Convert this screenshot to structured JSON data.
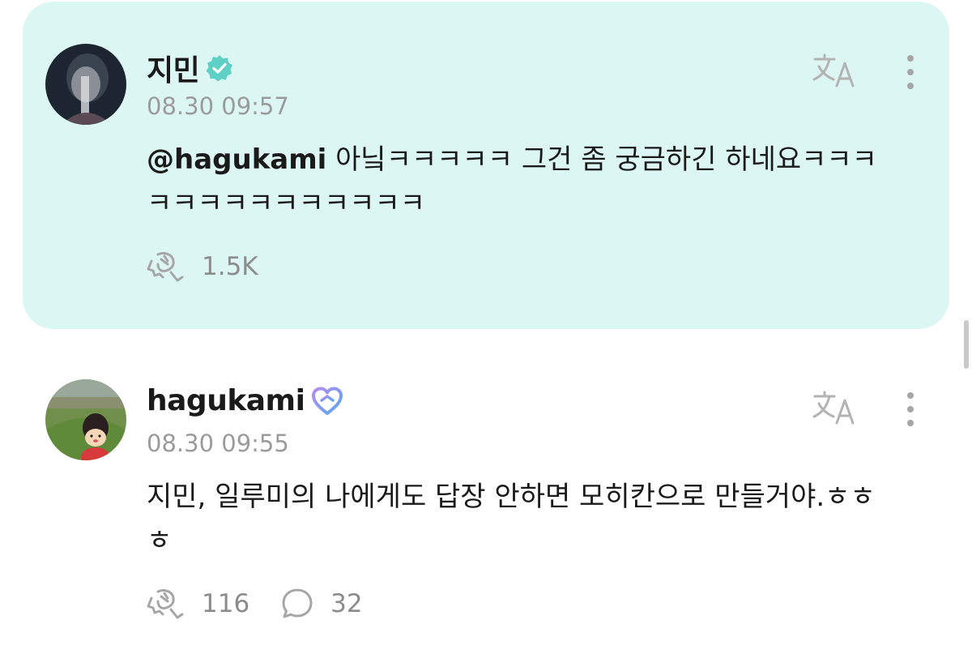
{
  "posts": [
    {
      "author": "지민",
      "verified_badge": "verified-check-icon",
      "badge_color": "#5fd0c4",
      "time": "08.30 09:57",
      "mention": "@hagukami",
      "text": " 아닠ㅋㅋㅋㅋㅋ 그건 좀 궁금하긴 하네요ㅋㅋㅋㅋㅋㅋㅋㅋㅋㅋㅋㅋㅋㅋ",
      "like_count": "1.5K",
      "background": "#dcf7f3"
    },
    {
      "author": "hagukami",
      "verified_badge": "heart-badge-icon",
      "badge_color": "#8c7cf0",
      "time": "08.30 09:55",
      "mention": "",
      "text": "지민, 일루미의 나에게도 답장 안하면 모히칸으로 만들거야.ㅎㅎㅎ",
      "like_count": "116",
      "comment_count": "32"
    }
  ]
}
